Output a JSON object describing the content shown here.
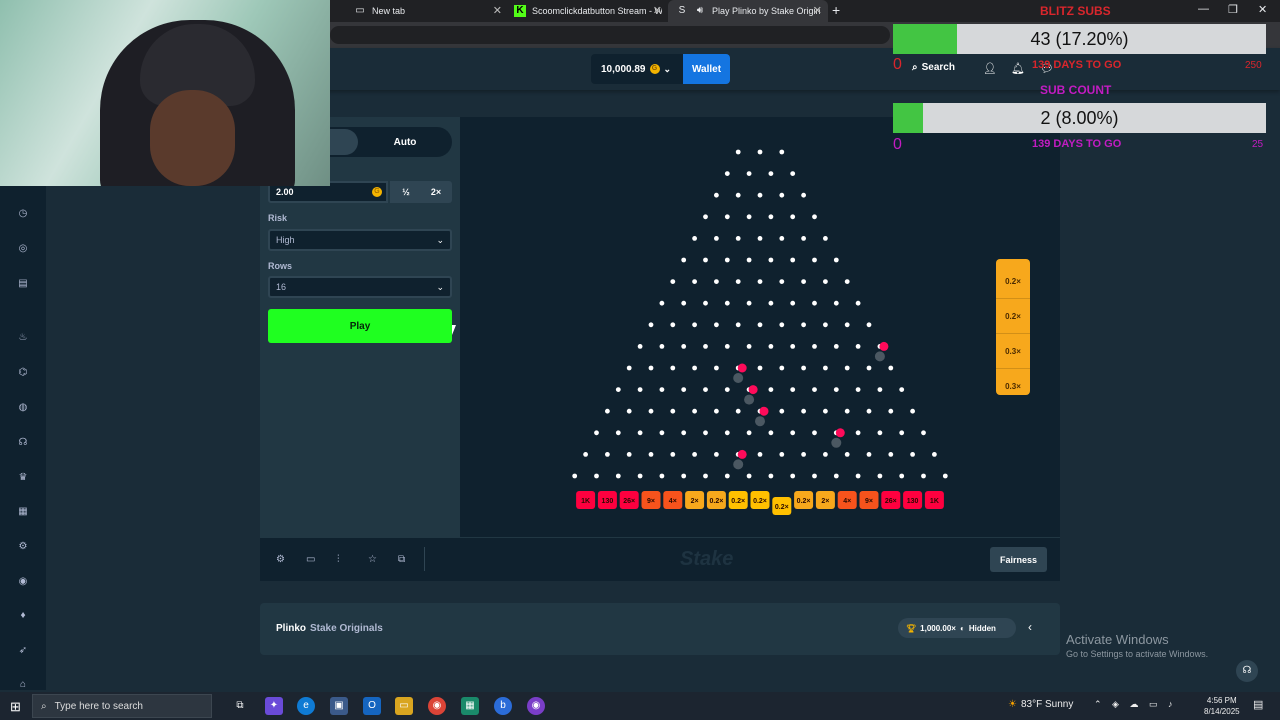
{
  "browser": {
    "tabs": [
      {
        "title": "New tab",
        "icon": "page-icon"
      },
      {
        "title": "Scoomclickdatbutton Stream - W",
        "icon": "kick-icon"
      },
      {
        "title": "Play Plinko by Stake Originals",
        "icon": "stake-icon"
      }
    ],
    "new_tab": "+",
    "minimize": "—",
    "restore": "❐",
    "close": "✕"
  },
  "header": {
    "balance": "10,000.89",
    "coin": "G",
    "balance_chevron": "⌄",
    "wallet_label": "Wallet",
    "search_label": "Search"
  },
  "controls": {
    "mode_auto": "Auto",
    "bet_amount": "2.00",
    "half_label": "½",
    "double_label": "2×",
    "risk_label": "Risk",
    "risk_value": "High",
    "rows_label": "Rows",
    "rows_value": "16",
    "play_label": "Play"
  },
  "board": {
    "rows": 16,
    "multipliers": [
      "1K",
      "130",
      "26×",
      "9×",
      "4×",
      "2×",
      "0.2×",
      "0.2×",
      "0.2×",
      "0.2×",
      "0.2×",
      "2×",
      "4×",
      "9×",
      "26×",
      "130",
      "1K"
    ],
    "active_slot": 9,
    "recent_results": [
      "0.2×",
      "0.2×",
      "0.3×",
      "0.3×"
    ],
    "colors": {
      "high": "#ff003f",
      "mid": "#f7531c",
      "low": "#f7a81c",
      "lowest": "#ffc000"
    },
    "balls": [
      {
        "row": 10,
        "col": 5
      },
      {
        "row": 11,
        "col": 6
      },
      {
        "row": 12,
        "col": 7
      },
      {
        "row": 9,
        "col": 11
      },
      {
        "row": 13,
        "col": 11
      },
      {
        "row": 14,
        "col": 7
      }
    ]
  },
  "footer": {
    "fairness_label": "Fairness",
    "brand": "Stake"
  },
  "info": {
    "game_name": "Plinko",
    "game_category": "Stake Originals",
    "max_win": "1,000.00×",
    "hidden_label": "Hidden"
  },
  "goals": {
    "follower_title": "BLITZ SUBS",
    "follower_text": "43 (17.20%)",
    "follower_progress": 0.172,
    "follower_min": "0",
    "follower_days": "139 DAYS TO GO",
    "follower_max": "250",
    "sub_title": "SUB COUNT",
    "sub_text": "2 (8.00%)",
    "sub_progress": 0.08,
    "sub_min": "0",
    "sub_days": "139 DAYS TO GO",
    "sub_max": "25"
  },
  "windows": {
    "activate_title": "Activate Windows",
    "activate_sub": "Go to Settings to activate Windows."
  },
  "taskbar": {
    "search_placeholder": "Type here to search",
    "weather": "83°F  Sunny",
    "time": "4:56 PM",
    "date": "8/14/2025"
  }
}
